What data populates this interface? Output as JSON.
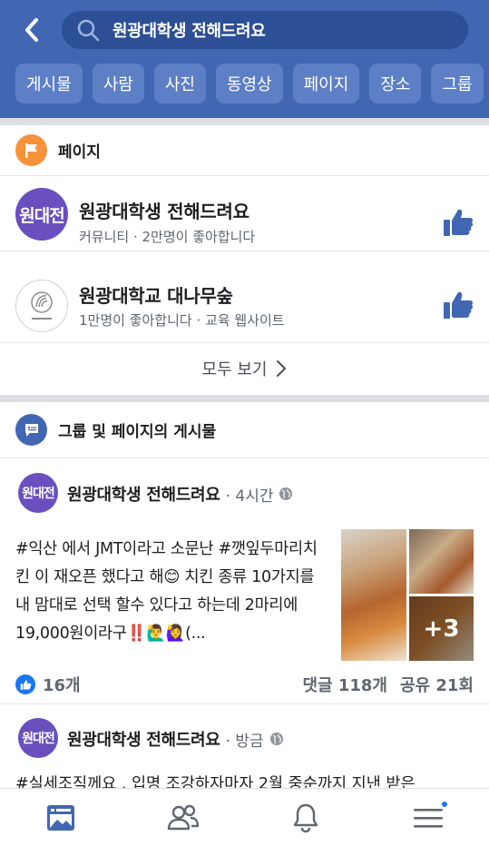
{
  "search": {
    "query": "원광대학생 전해드려요"
  },
  "filters": [
    "게시물",
    "사람",
    "사진",
    "동영상",
    "페이지",
    "장소",
    "그룹"
  ],
  "pages_section": {
    "title": "페이지",
    "items": [
      {
        "avatar_text": "원대전",
        "name": "원광대학생 전해드려요",
        "sub": "커뮤니티 · 2만명이 좋아합니다"
      },
      {
        "avatar_text": "",
        "name": "원광대학교 대나무숲",
        "sub": "1만명이 좋아합니다 · 교육 웹사이트"
      }
    ],
    "see_all": "모두 보기"
  },
  "posts_section": {
    "title": "그룹 및 페이지의 게시물",
    "posts": [
      {
        "avatar_text": "원대전",
        "author": "원광대학생 전해드려요",
        "time": "· 4시간",
        "text": "#익산 에서 JMT이라고 소문난 #깻잎두마리치킨 이 재오픈 했다고 해😊 치킨 종류 10가지를 내 맘대로 선택 할수 있다고 하는데 2마리에 19,000원이라구‼️🙋‍♂️🙋‍♀️(...",
        "more_photos": "+3",
        "likes": "16개",
        "comments": "댓글 118개",
        "shares": "공유 21회"
      },
      {
        "avatar_text": "원대전",
        "author": "원광대학생 전해드려요",
        "time": "· 방금",
        "text": "#실세조직께요 . 입명 조강하자마자 2월 중순까지 지낸 받은"
      }
    ]
  },
  "colors": {
    "header": "#4267b2",
    "accent": "#1877f2",
    "page_icon": "#f7923b"
  }
}
